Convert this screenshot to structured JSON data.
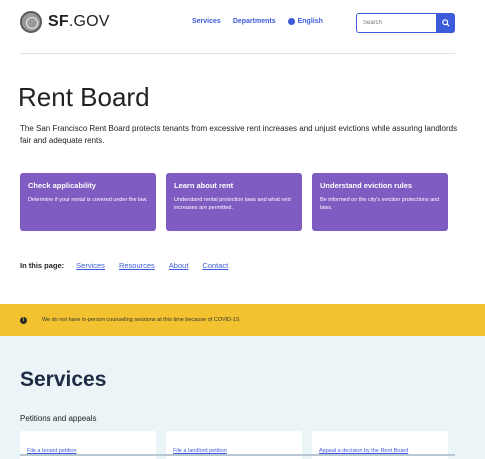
{
  "header": {
    "logo_bold": "SF",
    "logo_rest": ".GOV",
    "nav": [
      "Services",
      "Departments",
      "English"
    ],
    "search_placeholder": "Search"
  },
  "page": {
    "title": "Rent Board",
    "intro": "The San Francisco Rent Board protects tenants from excessive rent increases and unjust evictions while assuring landlords fair and adequate rents."
  },
  "cards": [
    {
      "title": "Check applicability",
      "desc": "Determine if your rental is covered under the law."
    },
    {
      "title": "Learn about rent",
      "desc": "Understand rental protection laws and what rent increases are permitted."
    },
    {
      "title": "Understand eviction rules",
      "desc": "Be informed on the city's eviction protections and laws."
    }
  ],
  "in_this_page": {
    "label": "In this page:",
    "links": [
      "Services",
      "Resources",
      "About",
      "Contact"
    ]
  },
  "alert": {
    "text": "We do not have in-person counseling sessions at this time because of COVID-19."
  },
  "services": {
    "heading": "Services",
    "subheading": "Petitions and appeals",
    "items": [
      "File a tenant petition",
      "File a landlord petition",
      "Appeal a decision by the Rent Board"
    ]
  },
  "colors": {
    "accent": "#3b5bdb",
    "card": "#7f5cc1",
    "alert": "#f2c230",
    "services_bg": "#ebf4f6"
  }
}
